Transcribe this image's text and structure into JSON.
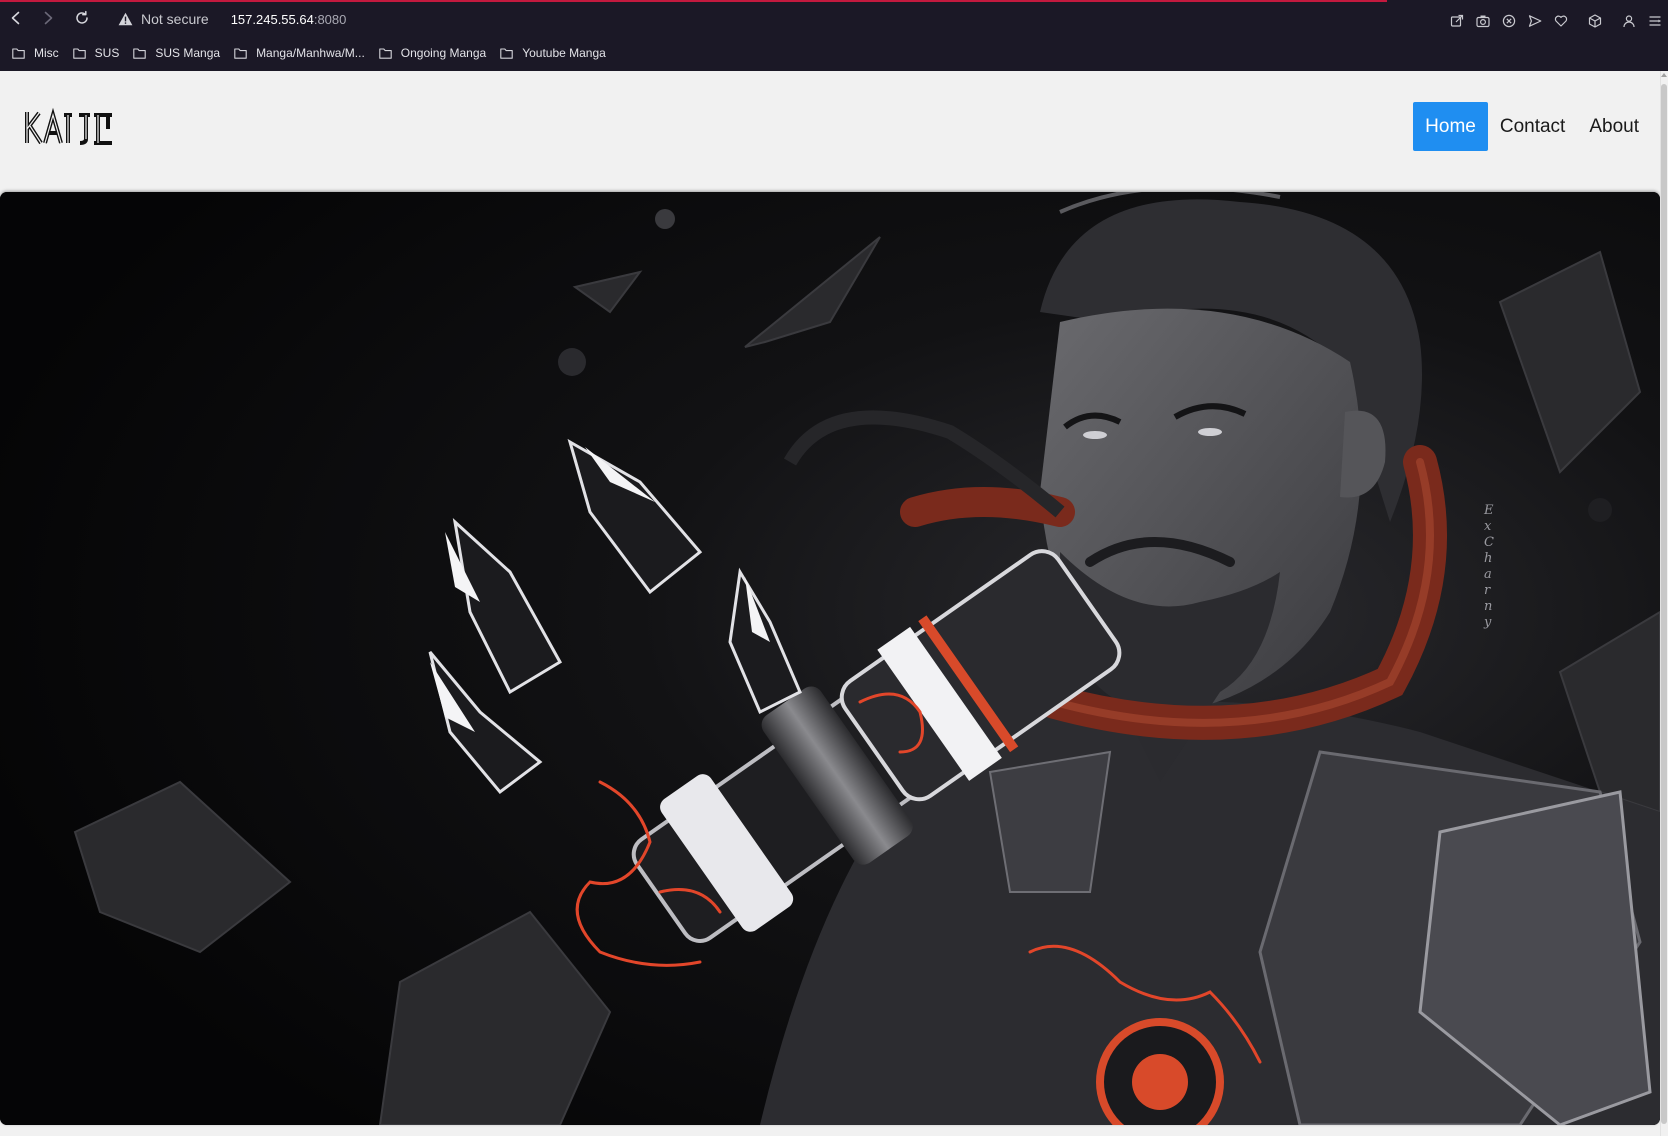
{
  "browser": {
    "security_label": "Not secure",
    "url_host": "157.245.55.64",
    "url_port": ":8080",
    "nav_icons": [
      "back-icon",
      "forward-icon",
      "reload-icon"
    ],
    "toolbar_icons": [
      "share-icon",
      "camera-icon",
      "close-circle-icon",
      "send-icon",
      "heart-icon",
      "box-icon",
      "profile-icon",
      "menu-icon"
    ],
    "bookmarks": [
      {
        "label": "Misc"
      },
      {
        "label": "SUS"
      },
      {
        "label": "SUS Manga"
      },
      {
        "label": "Manga/Manhwa/M..."
      },
      {
        "label": "Ongoing Manga"
      },
      {
        "label": "Youtube Manga"
      }
    ],
    "colors": {
      "chrome_bg": "#1b1826",
      "progress": "#c3193e"
    }
  },
  "site": {
    "logo_text": "KAIJI",
    "nav": [
      {
        "label": "Home",
        "active": true
      },
      {
        "label": "Contact",
        "active": false
      },
      {
        "label": "About",
        "active": false
      }
    ],
    "colors": {
      "accent": "#1f8ef1",
      "page_bg": "#f1f1f1"
    }
  },
  "hero": {
    "image_description_icon": "hero-artwork-icon",
    "signature": "ExCharny"
  }
}
